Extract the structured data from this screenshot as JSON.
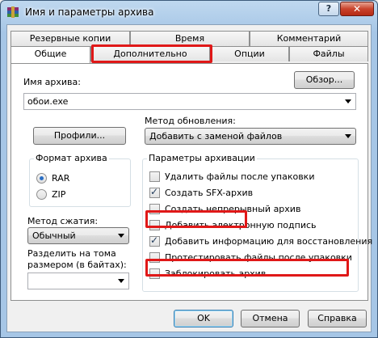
{
  "window": {
    "title": "Имя и параметры архива",
    "help": "?",
    "close": "✕"
  },
  "tabs": {
    "back_row": [
      "Резервные копии",
      "Время",
      "Комментарий"
    ],
    "front_row": [
      "Общие",
      "Дополнительно",
      "Опции",
      "Файлы"
    ],
    "active": "Общие"
  },
  "archive_name": {
    "label": "Имя архива:",
    "value": "обои.exe",
    "browse": "Обзор..."
  },
  "profiles": {
    "button": "Профили..."
  },
  "update_method": {
    "label": "Метод обновления:",
    "value": "Добавить с заменой файлов"
  },
  "archive_format": {
    "title": "Формат архива",
    "options": [
      {
        "label": "RAR",
        "checked": true
      },
      {
        "label": "ZIP",
        "checked": false
      }
    ]
  },
  "compression": {
    "label": "Метод сжатия:",
    "value": "Обычный"
  },
  "split": {
    "label_line1": "Разделить на тома",
    "label_line2": "размером (в байтах):",
    "value": ""
  },
  "archive_params": {
    "title": "Параметры архивации",
    "items": [
      {
        "label": "Удалить файлы после упаковки",
        "checked": false
      },
      {
        "label": "Создать SFX-архив",
        "checked": true
      },
      {
        "label": "Создать непрерывный архив",
        "checked": false
      },
      {
        "label": "Добавить электронную подпись",
        "checked": false
      },
      {
        "label": "Добавить информацию для восстановления",
        "checked": true
      },
      {
        "label": "Протестировать файлы после упаковки",
        "checked": false
      },
      {
        "label": "Заблокировать архив",
        "checked": false
      }
    ]
  },
  "footer": {
    "ok": "OK",
    "cancel": "Отмена",
    "help": "Справка"
  },
  "colors": {
    "highlight": "#e01818",
    "titlebar": "#a6c6e6",
    "close": "#c9432c"
  },
  "icons": {
    "app": "winrar-icon"
  }
}
